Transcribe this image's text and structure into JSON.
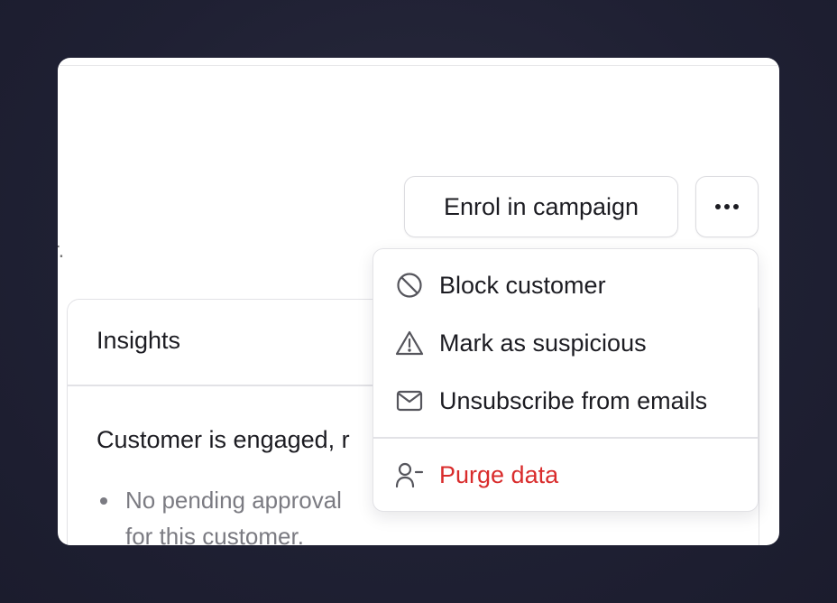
{
  "header": {
    "clipped_text": "r.",
    "enrol_button_label": "Enrol in campaign",
    "more_button_icon": "more-horizontal-icon"
  },
  "insights": {
    "title": "Insights",
    "summary": "Customer is engaged, r",
    "bullets": [
      "No pending approval",
      "for this customer."
    ]
  },
  "menu": {
    "items": [
      {
        "label": "Block customer",
        "icon": "ban-icon"
      },
      {
        "label": "Mark as suspicious",
        "icon": "warning-triangle-icon"
      },
      {
        "label": "Unsubscribe from emails",
        "icon": "mail-icon"
      }
    ],
    "danger_item": {
      "label": "Purge data",
      "icon": "user-minus-icon"
    }
  },
  "colors": {
    "background": "#1f2033",
    "danger": "#d92c2c",
    "text": "#1c1c22",
    "muted": "#7b7b82"
  }
}
